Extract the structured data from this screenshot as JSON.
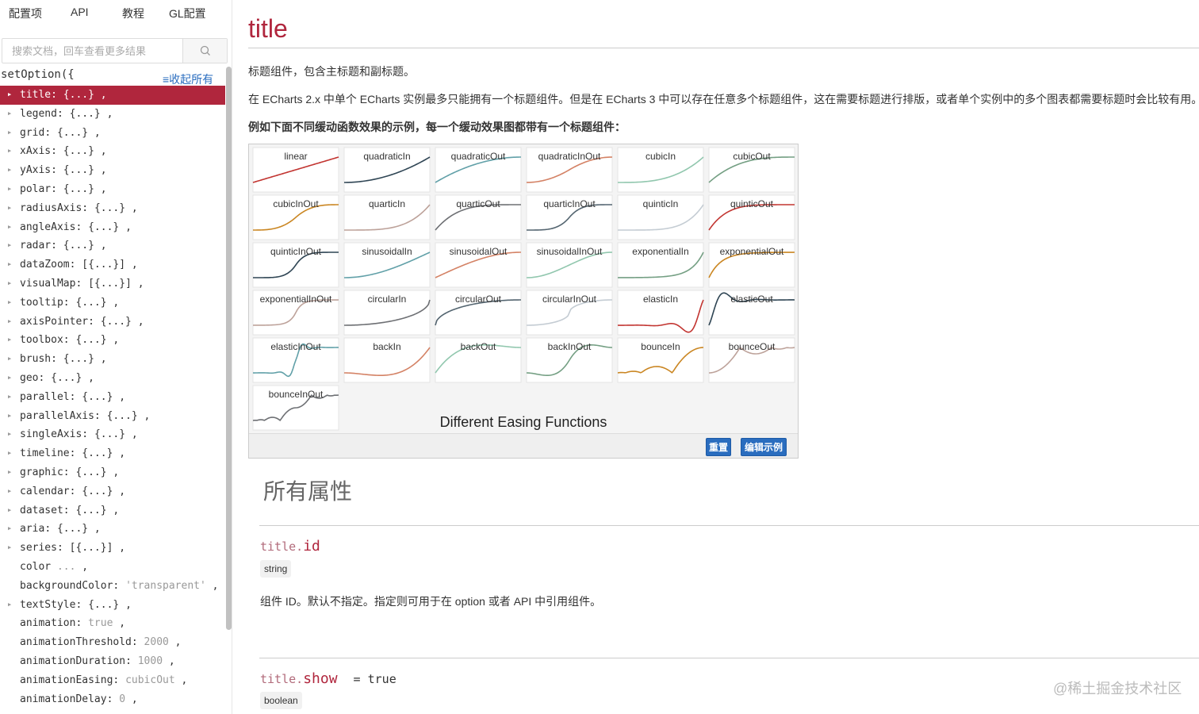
{
  "nav": [
    "配置项",
    "API",
    "教程",
    "GL配置"
  ],
  "search": {
    "placeholder": "搜索文档，回车查看更多结果"
  },
  "tree_header": {
    "setoption": "setOption({",
    "collapse": "≡收起所有"
  },
  "tree": [
    {
      "key": "title",
      "value": "{...}",
      "expandable": true,
      "active": true
    },
    {
      "key": "legend",
      "value": "{...}",
      "expandable": true
    },
    {
      "key": "grid",
      "value": "{...}",
      "expandable": true
    },
    {
      "key": "xAxis",
      "value": "{...}",
      "expandable": true
    },
    {
      "key": "yAxis",
      "value": "{...}",
      "expandable": true
    },
    {
      "key": "polar",
      "value": "{...}",
      "expandable": true
    },
    {
      "key": "radiusAxis",
      "value": "{...}",
      "expandable": true
    },
    {
      "key": "angleAxis",
      "value": "{...}",
      "expandable": true
    },
    {
      "key": "radar",
      "value": "{...}",
      "expandable": true
    },
    {
      "key": "dataZoom",
      "value": "[{...}]",
      "expandable": true
    },
    {
      "key": "visualMap",
      "value": "[{...}]",
      "expandable": true
    },
    {
      "key": "tooltip",
      "value": "{...}",
      "expandable": true
    },
    {
      "key": "axisPointer",
      "value": "{...}",
      "expandable": true
    },
    {
      "key": "toolbox",
      "value": "{...}",
      "expandable": true
    },
    {
      "key": "brush",
      "value": "{...}",
      "expandable": true
    },
    {
      "key": "geo",
      "value": "{...}",
      "expandable": true
    },
    {
      "key": "parallel",
      "value": "{...}",
      "expandable": true
    },
    {
      "key": "parallelAxis",
      "value": "{...}",
      "expandable": true
    },
    {
      "key": "singleAxis",
      "value": "{...}",
      "expandable": true
    },
    {
      "key": "timeline",
      "value": "{...}",
      "expandable": true
    },
    {
      "key": "graphic",
      "value": "{...}",
      "expandable": true
    },
    {
      "key": "calendar",
      "value": "{...}",
      "expandable": true
    },
    {
      "key": "dataset",
      "value": "{...}",
      "expandable": true
    },
    {
      "key": "aria",
      "value": "{...}",
      "expandable": true
    },
    {
      "key": "series",
      "value": "[{...}]",
      "expandable": true
    },
    {
      "key": "color",
      "value": "...",
      "expandable": false,
      "nocolon": true
    },
    {
      "key": "backgroundColor",
      "value": "'transparent'",
      "expandable": false
    },
    {
      "key": "textStyle",
      "value": "{...}",
      "expandable": true
    },
    {
      "key": "animation",
      "value": "true",
      "expandable": false
    },
    {
      "key": "animationThreshold",
      "value": "2000",
      "expandable": false
    },
    {
      "key": "animationDuration",
      "value": "1000",
      "expandable": false
    },
    {
      "key": "animationEasing",
      "value": "cubicOut",
      "expandable": false
    },
    {
      "key": "animationDelay",
      "value": "0",
      "expandable": false
    }
  ],
  "main": {
    "title": "title",
    "p1": "标题组件，包含主标题和副标题。",
    "p2": "在 ECharts 2.x 中单个 ECharts 实例最多只能拥有一个标题组件。但是在 ECharts 3 中可以存在任意多个标题组件，这在需要标题进行排版，或者单个实例中的多个图表都需要标题时会比较有用。",
    "p3": "例如下面不同缓动函数效果的示例，每一个缓动效果图都带有一个标题组件：",
    "all_props": "所有属性",
    "buttons": {
      "reset": "重置",
      "edit": "编辑示例"
    },
    "prop_id": {
      "prefix": "title.",
      "name": "id",
      "type": "string",
      "desc": "组件 ID。默认不指定。指定则可用于在 option 或者 API 中引用组件。"
    },
    "prop_show": {
      "prefix": "title.",
      "name": "show",
      "default": "= true",
      "type": "boolean"
    },
    "watermark": "@稀土掘金技术社区"
  },
  "demo": {
    "caption": "Different Easing Functions",
    "cells": [
      {
        "name": "linear",
        "color": "#c23531"
      },
      {
        "name": "quadraticIn",
        "color": "#2f4554"
      },
      {
        "name": "quadraticOut",
        "color": "#61a0a8"
      },
      {
        "name": "quadraticInOut",
        "color": "#d48265"
      },
      {
        "name": "cubicIn",
        "color": "#91c7ae"
      },
      {
        "name": "cubicOut",
        "color": "#749f83"
      },
      {
        "name": "cubicInOut",
        "color": "#ca8622"
      },
      {
        "name": "quarticIn",
        "color": "#bda29a"
      },
      {
        "name": "quarticOut",
        "color": "#6e7074"
      },
      {
        "name": "quarticInOut",
        "color": "#546570"
      },
      {
        "name": "quinticIn",
        "color": "#c4ccd3"
      },
      {
        "name": "quinticOut",
        "color": "#c23531"
      },
      {
        "name": "quinticInOut",
        "color": "#2f4554"
      },
      {
        "name": "sinusoidalIn",
        "color": "#61a0a8"
      },
      {
        "name": "sinusoidalOut",
        "color": "#d48265"
      },
      {
        "name": "sinusoidalInOut",
        "color": "#91c7ae"
      },
      {
        "name": "exponentialIn",
        "color": "#749f83"
      },
      {
        "name": "exponentialOut",
        "color": "#ca8622"
      },
      {
        "name": "exponentialInOut",
        "color": "#bda29a"
      },
      {
        "name": "circularIn",
        "color": "#6e7074"
      },
      {
        "name": "circularOut",
        "color": "#546570"
      },
      {
        "name": "circularInOut",
        "color": "#c4ccd3"
      },
      {
        "name": "elasticIn",
        "color": "#c23531"
      },
      {
        "name": "elasticOut",
        "color": "#2f4554"
      },
      {
        "name": "elasticInOut",
        "color": "#61a0a8"
      },
      {
        "name": "backIn",
        "color": "#d48265"
      },
      {
        "name": "backOut",
        "color": "#91c7ae"
      },
      {
        "name": "backInOut",
        "color": "#749f83"
      },
      {
        "name": "bounceIn",
        "color": "#ca8622"
      },
      {
        "name": "bounceOut",
        "color": "#bda29a"
      },
      {
        "name": "bounceInOut",
        "color": "#6e7074"
      }
    ]
  },
  "colors": {
    "accent": "#b0263d",
    "link": "#2a6dbf",
    "button": "#2a6dbf"
  }
}
